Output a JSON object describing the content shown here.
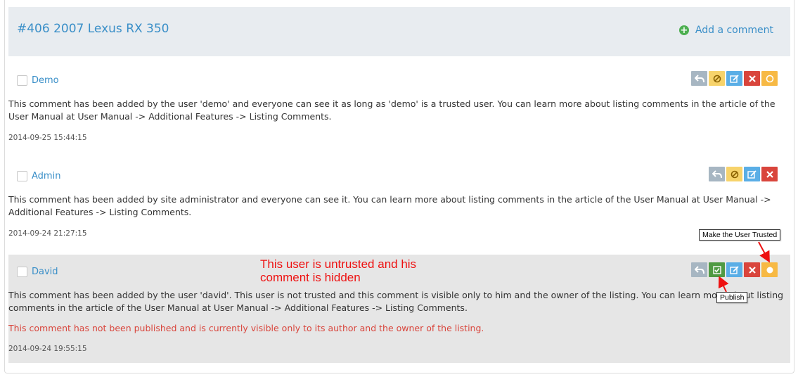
{
  "header": {
    "title": "#406 2007 Lexus RX 350",
    "add_comment_label": "Add a comment",
    "add_icon_glyph": "+"
  },
  "comments": [
    {
      "author": "Demo",
      "text": "This comment has been added by the user 'demo' and everyone can see it as long as 'demo' is a trusted user. You can learn more about listing comments in the article of the User Manual at User Manual -> Additional Features -> Listing Comments.",
      "date": "2014-09-25 15:44:15",
      "actions": [
        "reply-icon",
        "ban-icon",
        "edit-icon",
        "delete-icon",
        "trust-icon"
      ]
    },
    {
      "author": "Admin",
      "text": "This comment has been added by site administrator and everyone can see it. You can learn more about listing comments in the article of the User Manual at User Manual -> Additional Features -> Listing Comments.",
      "date": "2014-09-24 21:27:15",
      "actions": [
        "reply-icon",
        "ban-icon",
        "edit-icon",
        "delete-icon"
      ]
    },
    {
      "author": "David",
      "text": "This comment has been added by the user 'david'. This user is not trusted and this comment is visible only to him and the owner of the listing. You can learn more about listing comments in the article of the User Manual at User Manual -> Additional Features -> Listing Comments.",
      "note": "This comment has not been published and is currently visible only to its author and the owner of the listing.",
      "date": "2014-09-24 19:55:15",
      "actions": [
        "reply-icon",
        "publish-icon",
        "edit-icon",
        "delete-icon",
        "trust-icon"
      ]
    }
  ],
  "annotation": {
    "line1": "This user is untrusted and his",
    "line2": "comment is hidden"
  },
  "tooltips": {
    "trust": "Make the User Trusted",
    "publish": "Publish"
  },
  "colors": {
    "link": "#3a8fc8",
    "header_bg": "#e8ecf0",
    "hidden_bg": "#e6e6e6",
    "annotation": "#ee1111",
    "unpublished_note": "#d9453c"
  }
}
